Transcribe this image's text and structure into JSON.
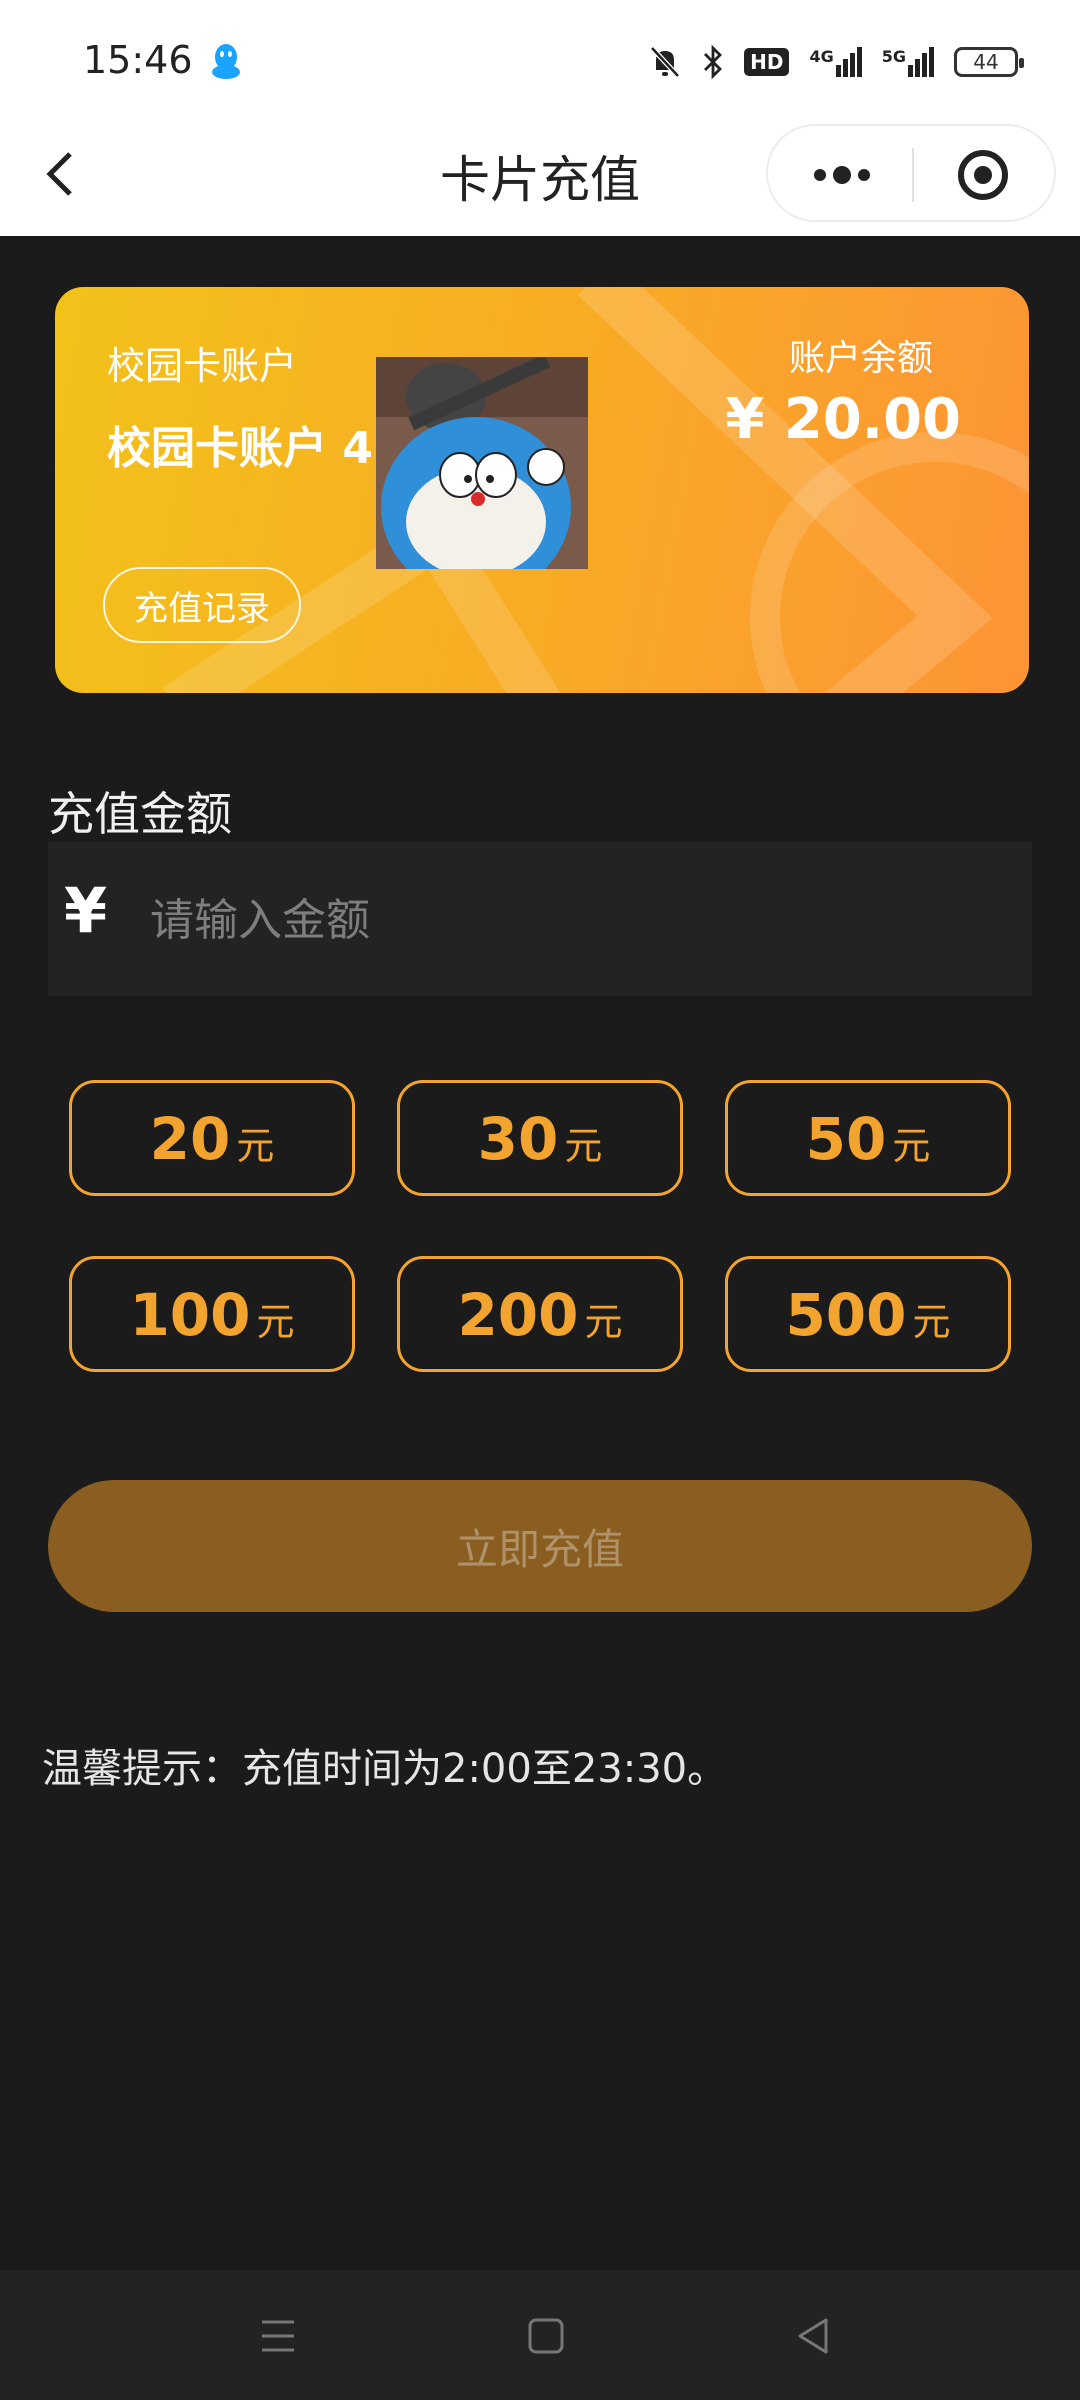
{
  "status": {
    "time": "15:46",
    "hd": "HD",
    "network_4g": "4G",
    "network_5g": "5G",
    "battery": "44"
  },
  "navbar": {
    "title": "卡片充值"
  },
  "card": {
    "label": "校园卡账户",
    "name": "校园卡账户 4",
    "balance_label": "账户余额",
    "balance_value": "¥ 20.00",
    "record_button": "充值记录"
  },
  "recharge": {
    "section_label": "充值金额",
    "currency_symbol": "¥",
    "placeholder": "请输入金额",
    "options": [
      {
        "amount": "20",
        "unit": "元"
      },
      {
        "amount": "30",
        "unit": "元"
      },
      {
        "amount": "50",
        "unit": "元"
      },
      {
        "amount": "100",
        "unit": "元"
      },
      {
        "amount": "200",
        "unit": "元"
      },
      {
        "amount": "500",
        "unit": "元"
      }
    ],
    "submit_label": "立即充值",
    "tip": "温馨提示：充值时间为2:00至23:30。"
  },
  "colors": {
    "accent": "#f3a42f",
    "background": "#1b1b1b",
    "card_start": "#f2c21a",
    "card_end": "#fd9436",
    "submit_bg": "#8a5e21"
  }
}
